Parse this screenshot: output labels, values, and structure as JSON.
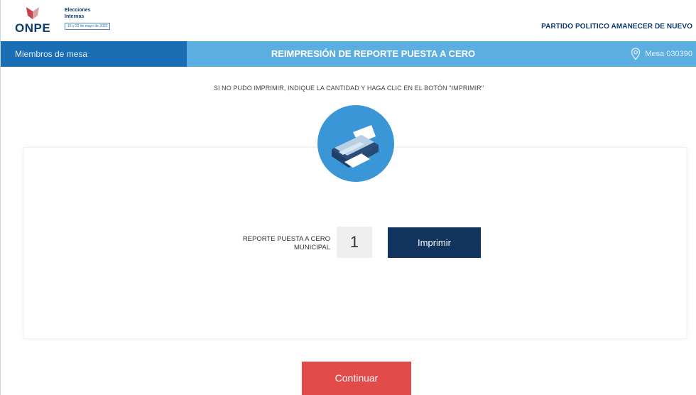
{
  "header": {
    "logo_text": "ONPE",
    "logo_sub_line1": "Elecciones",
    "logo_sub_line2": "Internas",
    "logo_date": "15 y 22 de mayo de 2022",
    "party_name": "PARTIDO POLITICO AMANECER DE NUEVO"
  },
  "bar": {
    "left_label": "Miembros de mesa",
    "title": "REIMPRESIÓN DE REPORTE PUESTA A CERO",
    "mesa_label": "Mesa 030390"
  },
  "instruction": "SI NO PUDO IMPRIMIR, INDIQUE LA CANTIDAD Y HAGA CLIC EN EL BOTÓN \"IMPRIMIR\"",
  "report": {
    "label_line1": "REPORTE PUESTA A CERO",
    "label_line2": "MUNICIPAL",
    "quantity": "1",
    "print_label": "Imprimir"
  },
  "continue_label": "Continuar",
  "icons": {
    "printer": "printer-icon",
    "location": "location-pin-icon",
    "logo": "onpe-logo"
  },
  "colors": {
    "bar_light": "#5aaee0",
    "bar_dark": "#1a6eb3",
    "print_button": "#10345e",
    "continue_button": "#e34b4b",
    "brand_navy": "#0d3c6e"
  }
}
